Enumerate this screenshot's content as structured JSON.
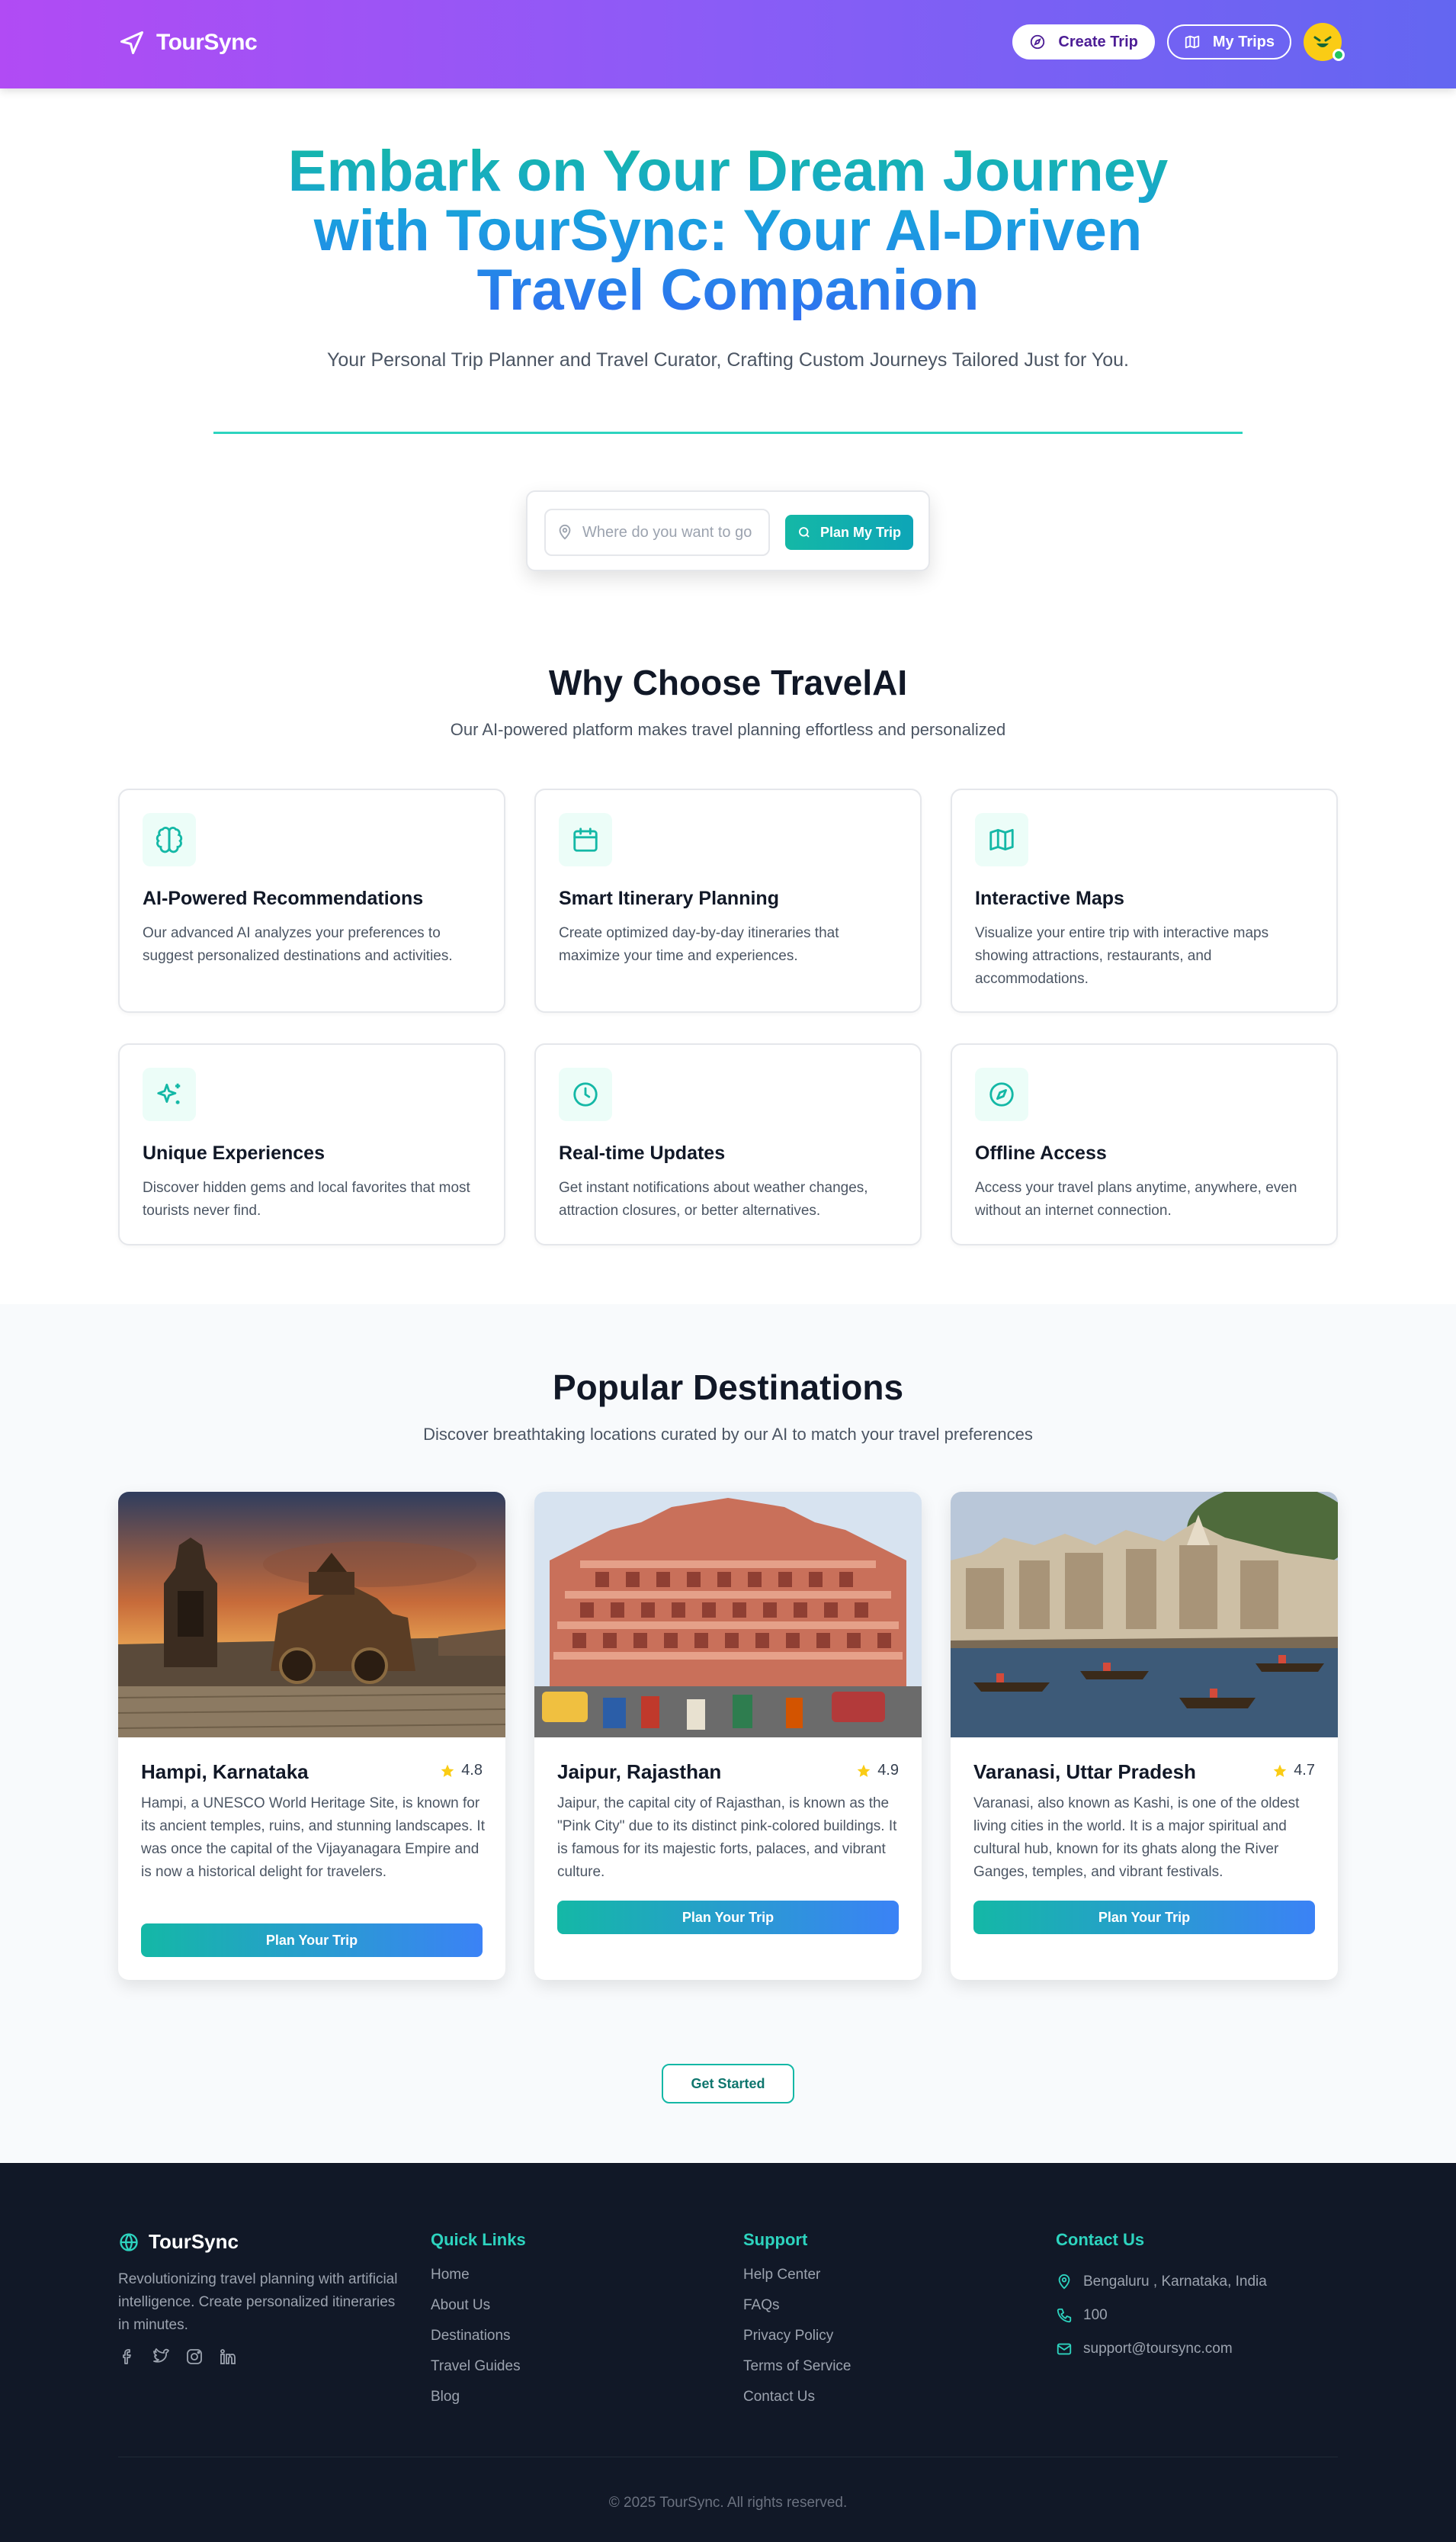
{
  "header": {
    "brand": "TourSync",
    "create_trip": "Create Trip",
    "my_trips": "My Trips"
  },
  "hero": {
    "title_line1": "Embark on Your Dream Journey",
    "title_line2": "with TourSync: Your AI-Driven",
    "title_line3": "Travel Companion",
    "subtitle": "Your Personal Trip Planner and Travel Curator, Crafting Custom Journeys Tailored Just for You.",
    "search_placeholder": "Where do you want to go",
    "search_button": "Plan My Trip"
  },
  "why": {
    "title": "Why Choose TravelAI",
    "subtitle": "Our AI-powered platform makes travel planning effortless and personalized",
    "features": [
      {
        "icon": "brain-icon",
        "title": "AI-Powered Recommendations",
        "desc": "Our advanced AI analyzes your preferences to suggest personalized destinations and activities."
      },
      {
        "icon": "calendar-icon",
        "title": "Smart Itinerary Planning",
        "desc": "Create optimized day-by-day itineraries that maximize your time and experiences."
      },
      {
        "icon": "map-icon",
        "title": "Interactive Maps",
        "desc": "Visualize your entire trip with interactive maps showing attractions, restaurants, and accommodations."
      },
      {
        "icon": "sparkles-icon",
        "title": "Unique Experiences",
        "desc": "Discover hidden gems and local favorites that most tourists never find."
      },
      {
        "icon": "clock-icon",
        "title": "Real-time Updates",
        "desc": "Get instant notifications about weather changes, attraction closures, or better alternatives."
      },
      {
        "icon": "compass-icon",
        "title": "Offline Access",
        "desc": "Access your travel plans anytime, anywhere, even without an internet connection."
      }
    ]
  },
  "destinations": {
    "title": "Popular Destinations",
    "subtitle": "Discover breathtaking locations curated by our AI to match your travel preferences",
    "items": [
      {
        "name": "Hampi, Karnataka",
        "rating": "4.8",
        "desc": "Hampi, a UNESCO World Heritage Site, is known for its ancient temples, ruins, and stunning landscapes. It was once the capital of the Vijayanagara Empire and is now a historical delight for travelers.",
        "button": "Plan Your Trip"
      },
      {
        "name": "Jaipur, Rajasthan",
        "rating": "4.9",
        "desc": "Jaipur, the capital city of Rajasthan, is known as the \"Pink City\" due to its distinct pink-colored buildings. It is famous for its majestic forts, palaces, and vibrant culture.",
        "button": "Plan Your Trip"
      },
      {
        "name": "Varanasi, Uttar Pradesh",
        "rating": "4.7",
        "desc": "Varanasi, also known as Kashi, is one of the oldest living cities in the world. It is a major spiritual and cultural hub, known for its ghats along the River Ganges, temples, and vibrant festivals.",
        "button": "Plan Your Trip"
      }
    ],
    "get_started": "Get Started"
  },
  "footer": {
    "brand": "TourSync",
    "desc": "Revolutionizing travel planning with artificial intelligence. Create personalized itineraries in minutes.",
    "quick_links_title": "Quick Links",
    "quick_links": [
      "Home",
      "About Us",
      "Destinations",
      "Travel Guides",
      "Blog"
    ],
    "support_title": "Support",
    "support_links": [
      "Help Center",
      "FAQs",
      "Privacy Policy",
      "Terms of Service",
      "Contact Us"
    ],
    "contact_title": "Contact Us",
    "address": "Bengaluru , Karnataka, India",
    "phone": "100",
    "email": "support@toursync.com",
    "copyright": "© 2025 TourSync. All rights reserved."
  },
  "colors": {
    "accent_teal": "#14b8a6",
    "accent_blue": "#3b82f6",
    "header_purple": "#8a5cf6",
    "footer_bg": "#111827",
    "star": "#facc15"
  }
}
